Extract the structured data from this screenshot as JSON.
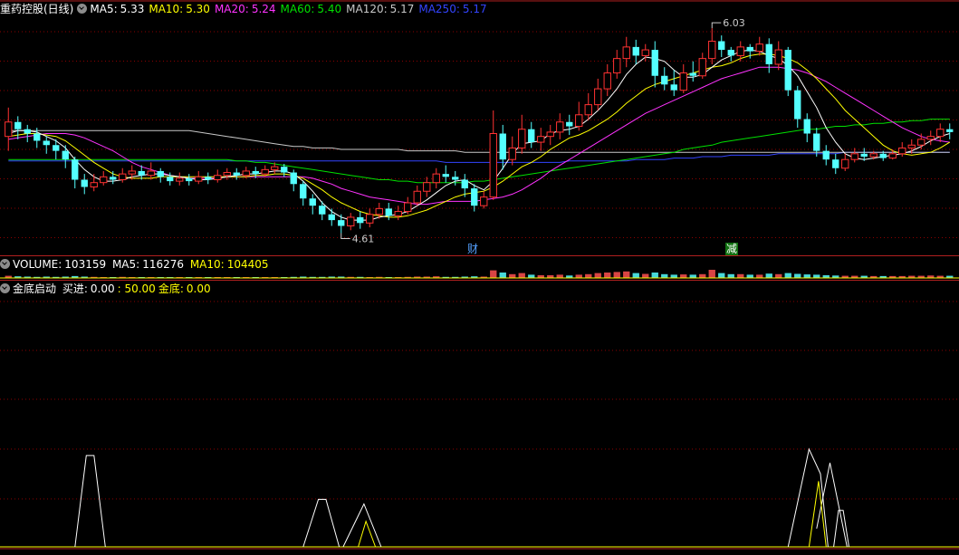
{
  "main_header": {
    "title": "重药控股(日线)",
    "ma": [
      {
        "label": "MA5:",
        "value": "5.33",
        "color": "#ffffff"
      },
      {
        "label": "MA10:",
        "value": "5.30",
        "color": "#ffff00"
      },
      {
        "label": "MA20:",
        "value": "5.24",
        "color": "#ff33ff"
      },
      {
        "label": "MA60:",
        "value": "5.40",
        "color": "#00e000"
      },
      {
        "label": "MA120:",
        "value": "5.17",
        "color": "#c8c8c8"
      },
      {
        "label": "MA250:",
        "value": "5.17",
        "color": "#3344ff"
      }
    ]
  },
  "volume_header": {
    "title": "VOLUME:",
    "value": "103159",
    "ma5_label": "MA5:",
    "ma5_value": "116276",
    "ma10_label": "MA10:",
    "ma10_value": "104405"
  },
  "indicator_header": {
    "title": "金底启动",
    "buy_label": "买进:",
    "buy_value": "0.00",
    "ref_value": ": 50.00",
    "gold_label": "金底:",
    "gold_value": "0.00"
  },
  "markers": {
    "high_label": "6.03",
    "low_label": "4.61",
    "event1": "财",
    "event2": "减"
  },
  "colors": {
    "up": "#ff3232",
    "down": "#54ffff",
    "grid": "#8b0000",
    "separator": "#b02020"
  },
  "chart_data": {
    "type": "candlestick",
    "price_range": [
      4.5,
      6.1
    ],
    "candles": [
      [
        5.28,
        5.38,
        5.18,
        5.48
      ],
      [
        5.38,
        5.33,
        5.26,
        5.42
      ],
      [
        5.33,
        5.3,
        5.24,
        5.36
      ],
      [
        5.3,
        5.25,
        5.2,
        5.34
      ],
      [
        5.25,
        5.22,
        5.16,
        5.28
      ],
      [
        5.22,
        5.18,
        5.12,
        5.26
      ],
      [
        5.18,
        5.12,
        5.06,
        5.22
      ],
      [
        5.12,
        4.98,
        4.92,
        5.14
      ],
      [
        4.98,
        4.93,
        4.88,
        5.02
      ],
      [
        4.93,
        4.96,
        4.9,
        5.02
      ],
      [
        4.96,
        5.0,
        4.94,
        5.04
      ],
      [
        5.0,
        4.98,
        4.95,
        5.04
      ],
      [
        4.98,
        5.02,
        4.96,
        5.06
      ],
      [
        5.02,
        5.04,
        4.98,
        5.08
      ],
      [
        5.04,
        5.01,
        4.98,
        5.08
      ],
      [
        5.01,
        5.04,
        4.98,
        5.1
      ],
      [
        5.04,
        5.0,
        4.96,
        5.06
      ],
      [
        5.0,
        4.97,
        4.94,
        5.03
      ],
      [
        4.97,
        4.99,
        4.94,
        5.03
      ],
      [
        4.99,
        4.97,
        4.94,
        5.02
      ],
      [
        4.97,
        5.0,
        4.95,
        5.04
      ],
      [
        5.0,
        4.98,
        4.95,
        5.03
      ],
      [
        4.98,
        5.01,
        4.96,
        5.05
      ],
      [
        5.01,
        5.03,
        4.98,
        5.06
      ],
      [
        5.03,
        5.01,
        4.98,
        5.06
      ],
      [
        5.01,
        5.04,
        4.99,
        5.07
      ],
      [
        5.04,
        5.02,
        4.99,
        5.07
      ],
      [
        5.02,
        5.05,
        5.0,
        5.08
      ],
      [
        5.05,
        5.07,
        5.02,
        5.1
      ],
      [
        5.07,
        5.03,
        5.0,
        5.09
      ],
      [
        5.03,
        4.95,
        4.9,
        5.05
      ],
      [
        4.95,
        4.85,
        4.8,
        4.97
      ],
      [
        4.85,
        4.8,
        4.74,
        4.88
      ],
      [
        4.8,
        4.74,
        4.7,
        4.83
      ],
      [
        4.74,
        4.7,
        4.66,
        4.78
      ],
      [
        4.7,
        4.66,
        4.61,
        4.74
      ],
      [
        4.66,
        4.72,
        4.63,
        4.75
      ],
      [
        4.72,
        4.68,
        4.64,
        4.76
      ],
      [
        4.68,
        4.74,
        4.65,
        4.78
      ],
      [
        4.74,
        4.78,
        4.71,
        4.82
      ],
      [
        4.78,
        4.73,
        4.7,
        4.82
      ],
      [
        4.73,
        4.76,
        4.7,
        4.8
      ],
      [
        4.76,
        4.82,
        4.74,
        4.86
      ],
      [
        4.82,
        4.9,
        4.8,
        4.94
      ],
      [
        4.9,
        4.96,
        4.86,
        5.0
      ],
      [
        4.96,
        5.02,
        4.92,
        5.06
      ],
      [
        5.02,
        5.0,
        4.96,
        5.08
      ],
      [
        5.0,
        4.98,
        4.94,
        5.04
      ],
      [
        4.98,
        4.92,
        4.86,
        5.02
      ],
      [
        4.92,
        4.8,
        4.76,
        4.95
      ],
      [
        4.8,
        4.86,
        4.78,
        4.9
      ],
      [
        4.86,
        5.3,
        4.84,
        5.46
      ],
      [
        5.3,
        5.12,
        5.05,
        5.36
      ],
      [
        5.12,
        5.2,
        5.08,
        5.28
      ],
      [
        5.2,
        5.33,
        5.16,
        5.43
      ],
      [
        5.33,
        5.24,
        5.2,
        5.38
      ],
      [
        5.24,
        5.28,
        5.18,
        5.34
      ],
      [
        5.28,
        5.31,
        5.22,
        5.36
      ],
      [
        5.31,
        5.38,
        5.26,
        5.44
      ],
      [
        5.38,
        5.35,
        5.29,
        5.43
      ],
      [
        5.35,
        5.43,
        5.32,
        5.52
      ],
      [
        5.43,
        5.5,
        5.39,
        5.58
      ],
      [
        5.5,
        5.61,
        5.46,
        5.68
      ],
      [
        5.61,
        5.72,
        5.56,
        5.78
      ],
      [
        5.72,
        5.82,
        5.68,
        5.88
      ],
      [
        5.82,
        5.9,
        5.76,
        5.97
      ],
      [
        5.9,
        5.84,
        5.78,
        5.95
      ],
      [
        5.84,
        5.88,
        5.8,
        5.92
      ],
      [
        5.88,
        5.7,
        5.62,
        5.94
      ],
      [
        5.7,
        5.64,
        5.6,
        5.76
      ],
      [
        5.64,
        5.6,
        5.56,
        5.74
      ],
      [
        5.6,
        5.72,
        5.58,
        5.78
      ],
      [
        5.72,
        5.7,
        5.66,
        5.8
      ],
      [
        5.7,
        5.82,
        5.68,
        5.86
      ],
      [
        5.82,
        5.94,
        5.78,
        6.03
      ],
      [
        5.94,
        5.88,
        5.83,
        5.98
      ],
      [
        5.88,
        5.84,
        5.8,
        5.9
      ],
      [
        5.84,
        5.9,
        5.8,
        5.94
      ],
      [
        5.9,
        5.87,
        5.82,
        5.92
      ],
      [
        5.87,
        5.92,
        5.84,
        5.97
      ],
      [
        5.92,
        5.78,
        5.72,
        5.96
      ],
      [
        5.78,
        5.88,
        5.74,
        5.94
      ],
      [
        5.88,
        5.6,
        5.56,
        5.9
      ],
      [
        5.6,
        5.4,
        5.34,
        5.63
      ],
      [
        5.4,
        5.3,
        5.24,
        5.44
      ],
      [
        5.3,
        5.18,
        5.14,
        5.34
      ],
      [
        5.18,
        5.12,
        5.08,
        5.22
      ],
      [
        5.12,
        5.06,
        5.02,
        5.16
      ],
      [
        5.06,
        5.12,
        5.04,
        5.16
      ],
      [
        5.12,
        5.16,
        5.1,
        5.2
      ],
      [
        5.16,
        5.14,
        5.11,
        5.2
      ],
      [
        5.14,
        5.16,
        5.12,
        5.18
      ],
      [
        5.16,
        5.13,
        5.11,
        5.18
      ],
      [
        5.13,
        5.16,
        5.12,
        5.19
      ],
      [
        5.16,
        5.2,
        5.14,
        5.24
      ],
      [
        5.2,
        5.22,
        5.16,
        5.26
      ],
      [
        5.22,
        5.26,
        5.19,
        5.3
      ],
      [
        5.26,
        5.28,
        5.22,
        5.32
      ],
      [
        5.28,
        5.33,
        5.24,
        5.37
      ],
      [
        5.33,
        5.31,
        5.26,
        5.37
      ]
    ],
    "ma5": [
      5.3,
      5.32,
      5.32,
      5.31,
      5.28,
      5.25,
      5.2,
      5.12,
      5.05,
      5.0,
      4.97,
      4.97,
      4.98,
      5.0,
      5.01,
      5.02,
      5.02,
      5.01,
      5.0,
      4.99,
      4.98,
      4.98,
      4.99,
      5.0,
      5.01,
      5.02,
      5.02,
      5.03,
      5.04,
      5.04,
      5.02,
      4.97,
      4.9,
      4.82,
      4.76,
      4.72,
      4.7,
      4.7,
      4.7,
      4.72,
      4.73,
      4.74,
      4.76,
      4.8,
      4.84,
      4.89,
      4.94,
      4.97,
      4.98,
      4.94,
      4.91,
      4.97,
      5.06,
      5.16,
      5.23,
      5.24,
      5.25,
      5.3,
      5.32,
      5.33,
      5.35,
      5.4,
      5.46,
      5.53,
      5.61,
      5.71,
      5.78,
      5.83,
      5.82,
      5.8,
      5.74,
      5.69,
      5.69,
      5.71,
      5.76,
      5.81,
      5.84,
      5.87,
      5.88,
      5.87,
      5.84,
      5.82,
      5.77,
      5.7,
      5.59,
      5.48,
      5.34,
      5.24,
      5.16,
      5.13,
      5.12,
      5.13,
      5.14,
      5.15,
      5.16,
      5.18,
      5.21,
      5.25,
      5.28,
      5.3
    ],
    "ma10": [
      5.28,
      5.29,
      5.3,
      5.3,
      5.29,
      5.28,
      5.25,
      5.2,
      5.15,
      5.1,
      5.06,
      5.02,
      5.0,
      4.99,
      4.99,
      4.99,
      5.0,
      5.0,
      5.0,
      5.0,
      5.0,
      5.0,
      5.0,
      5.0,
      5.0,
      5.0,
      5.01,
      5.01,
      5.02,
      5.02,
      5.01,
      4.99,
      4.95,
      4.91,
      4.86,
      4.82,
      4.79,
      4.76,
      4.74,
      4.73,
      4.72,
      4.72,
      4.73,
      4.75,
      4.77,
      4.8,
      4.83,
      4.86,
      4.88,
      4.89,
      4.9,
      4.93,
      4.97,
      5.02,
      5.07,
      5.1,
      5.14,
      5.19,
      5.23,
      5.27,
      5.29,
      5.32,
      5.36,
      5.4,
      5.45,
      5.51,
      5.56,
      5.61,
      5.64,
      5.66,
      5.68,
      5.7,
      5.72,
      5.74,
      5.76,
      5.77,
      5.79,
      5.82,
      5.84,
      5.85,
      5.85,
      5.84,
      5.82,
      5.79,
      5.74,
      5.68,
      5.61,
      5.54,
      5.46,
      5.4,
      5.34,
      5.28,
      5.22,
      5.18,
      5.16,
      5.15,
      5.16,
      5.17,
      5.2,
      5.24
    ],
    "ma20": [
      5.26,
      5.27,
      5.28,
      5.29,
      5.3,
      5.3,
      5.3,
      5.29,
      5.27,
      5.24,
      5.21,
      5.18,
      5.14,
      5.1,
      5.07,
      5.05,
      5.03,
      5.01,
      5.0,
      4.99,
      4.99,
      4.99,
      4.99,
      5.0,
      5.0,
      5.0,
      5.0,
      5.0,
      5.0,
      5.0,
      5.0,
      5.0,
      4.99,
      4.97,
      4.95,
      4.92,
      4.9,
      4.88,
      4.86,
      4.85,
      4.84,
      4.83,
      4.82,
      4.81,
      4.81,
      4.82,
      4.83,
      4.83,
      4.83,
      4.83,
      4.84,
      4.85,
      4.86,
      4.88,
      4.91,
      4.95,
      4.99,
      5.04,
      5.08,
      5.12,
      5.16,
      5.2,
      5.24,
      5.28,
      5.32,
      5.36,
      5.4,
      5.44,
      5.47,
      5.5,
      5.53,
      5.56,
      5.59,
      5.62,
      5.65,
      5.68,
      5.7,
      5.72,
      5.74,
      5.76,
      5.76,
      5.76,
      5.75,
      5.74,
      5.72,
      5.69,
      5.66,
      5.62,
      5.58,
      5.54,
      5.5,
      5.46,
      5.42,
      5.38,
      5.34,
      5.31,
      5.28,
      5.26,
      5.25,
      5.24
    ],
    "ma60": [
      5.12,
      5.12,
      5.12,
      5.12,
      5.12,
      5.12,
      5.12,
      5.12,
      5.12,
      5.12,
      5.12,
      5.12,
      5.12,
      5.12,
      5.12,
      5.12,
      5.12,
      5.12,
      5.12,
      5.12,
      5.12,
      5.12,
      5.12,
      5.12,
      5.11,
      5.11,
      5.1,
      5.1,
      5.09,
      5.08,
      5.07,
      5.06,
      5.05,
      5.04,
      5.03,
      5.02,
      5.01,
      5.0,
      4.99,
      4.98,
      4.98,
      4.97,
      4.97,
      4.96,
      4.96,
      4.96,
      4.96,
      4.96,
      4.96,
      4.97,
      4.97,
      4.98,
      4.99,
      5.0,
      5.01,
      5.02,
      5.03,
      5.04,
      5.05,
      5.06,
      5.07,
      5.08,
      5.09,
      5.1,
      5.11,
      5.12,
      5.13,
      5.14,
      5.15,
      5.16,
      5.17,
      5.19,
      5.2,
      5.21,
      5.22,
      5.24,
      5.25,
      5.26,
      5.27,
      5.28,
      5.29,
      5.3,
      5.31,
      5.32,
      5.33,
      5.33,
      5.34,
      5.35,
      5.35,
      5.36,
      5.36,
      5.37,
      5.37,
      5.38,
      5.38,
      5.39,
      5.39,
      5.4,
      5.4,
      5.4
    ],
    "ma120": [
      5.32,
      5.32,
      5.32,
      5.32,
      5.32,
      5.32,
      5.32,
      5.32,
      5.32,
      5.32,
      5.32,
      5.32,
      5.32,
      5.32,
      5.32,
      5.32,
      5.32,
      5.32,
      5.32,
      5.32,
      5.31,
      5.3,
      5.29,
      5.28,
      5.27,
      5.26,
      5.25,
      5.24,
      5.23,
      5.22,
      5.21,
      5.21,
      5.2,
      5.2,
      5.2,
      5.19,
      5.19,
      5.19,
      5.19,
      5.19,
      5.19,
      5.19,
      5.18,
      5.18,
      5.18,
      5.18,
      5.18,
      5.18,
      5.17,
      5.17,
      5.17,
      5.17,
      5.17,
      5.17,
      5.17,
      5.17,
      5.17,
      5.17,
      5.17,
      5.17,
      5.17,
      5.17,
      5.17,
      5.17,
      5.17,
      5.17,
      5.17,
      5.17,
      5.17,
      5.17,
      5.17,
      5.17,
      5.17,
      5.17,
      5.17,
      5.17,
      5.17,
      5.17,
      5.17,
      5.17,
      5.17,
      5.17,
      5.17,
      5.17,
      5.17,
      5.17,
      5.17,
      5.17,
      5.17,
      5.17,
      5.17,
      5.17,
      5.17,
      5.17,
      5.17,
      5.17,
      5.17,
      5.17,
      5.17,
      5.17
    ],
    "ma250": [
      5.11,
      5.11,
      5.11,
      5.11,
      5.11,
      5.11,
      5.11,
      5.11,
      5.11,
      5.11,
      5.11,
      5.11,
      5.11,
      5.11,
      5.11,
      5.11,
      5.11,
      5.11,
      5.11,
      5.11,
      5.11,
      5.11,
      5.11,
      5.11,
      5.11,
      5.11,
      5.11,
      5.11,
      5.11,
      5.11,
      5.11,
      5.11,
      5.11,
      5.11,
      5.11,
      5.11,
      5.11,
      5.11,
      5.11,
      5.11,
      5.11,
      5.11,
      5.11,
      5.11,
      5.11,
      5.11,
      5.1,
      5.1,
      5.1,
      5.1,
      5.1,
      5.1,
      5.1,
      5.1,
      5.1,
      5.1,
      5.1,
      5.1,
      5.1,
      5.11,
      5.11,
      5.11,
      5.11,
      5.11,
      5.11,
      5.11,
      5.12,
      5.12,
      5.12,
      5.12,
      5.13,
      5.13,
      5.13,
      5.14,
      5.14,
      5.14,
      5.15,
      5.15,
      5.15,
      5.15,
      5.15,
      5.16,
      5.16,
      5.16,
      5.16,
      5.16,
      5.16,
      5.16,
      5.17,
      5.17,
      5.17,
      5.17,
      5.17,
      5.17,
      5.17,
      5.17,
      5.17,
      5.17,
      5.17,
      5.17
    ],
    "volume": [
      0.08,
      0.06,
      0.05,
      0.04,
      0.05,
      0.04,
      0.05,
      0.07,
      0.05,
      0.04,
      0.03,
      0.03,
      0.04,
      0.03,
      0.03,
      0.03,
      0.03,
      0.03,
      0.02,
      0.02,
      0.03,
      0.02,
      0.02,
      0.03,
      0.02,
      0.03,
      0.02,
      0.03,
      0.03,
      0.03,
      0.04,
      0.05,
      0.04,
      0.04,
      0.05,
      0.05,
      0.04,
      0.04,
      0.03,
      0.04,
      0.03,
      0.03,
      0.04,
      0.05,
      0.05,
      0.06,
      0.04,
      0.04,
      0.05,
      0.06,
      0.05,
      0.28,
      0.2,
      0.14,
      0.18,
      0.12,
      0.1,
      0.1,
      0.12,
      0.09,
      0.12,
      0.14,
      0.18,
      0.2,
      0.22,
      0.24,
      0.18,
      0.15,
      0.2,
      0.14,
      0.12,
      0.13,
      0.12,
      0.14,
      0.3,
      0.18,
      0.14,
      0.14,
      0.12,
      0.12,
      0.16,
      0.14,
      0.18,
      0.15,
      0.13,
      0.12,
      0.1,
      0.09,
      0.08,
      0.08,
      0.08,
      0.07,
      0.07,
      0.07,
      0.07,
      0.08,
      0.08,
      0.09,
      0.08,
      0.08
    ],
    "indicator": {
      "gold_bottom": [
        [
          0.0,
          0.08,
          0.12,
          0.2
        ],
        [
          0.4,
          0.43,
          0.45,
          0.48
        ],
        [
          0.5,
          0.52,
          0.55,
          0.6
        ],
        [
          0.84,
          0.86,
          0.88,
          0.92
        ]
      ],
      "peaks": [
        {
          "series": "white",
          "points": [
            [
              7,
              0
            ],
            [
              8.2,
              100
            ],
            [
              9,
              100
            ],
            [
              10.2,
              0
            ]
          ]
        },
        {
          "series": "white",
          "points": [
            [
              31,
              0
            ],
            [
              32.6,
              52
            ],
            [
              33.4,
              52
            ],
            [
              34.8,
              0
            ]
          ]
        },
        {
          "series": "white",
          "points": [
            [
              35.2,
              0
            ],
            [
              37.4,
              47
            ],
            [
              39.2,
              0
            ]
          ]
        },
        {
          "series": "yellow",
          "points": [
            [
              36.8,
              0
            ],
            [
              37.6,
              28
            ],
            [
              38.6,
              0
            ]
          ]
        },
        {
          "series": "white",
          "points": [
            [
              82,
              0
            ],
            [
              84.2,
              107
            ],
            [
              85.4,
              80
            ],
            [
              86.2,
              0
            ]
          ]
        },
        {
          "series": "white",
          "points": [
            [
              85,
              20
            ],
            [
              86.4,
              92
            ],
            [
              88.2,
              0
            ]
          ]
        },
        {
          "series": "yellow",
          "points": [
            [
              84.2,
              0
            ],
            [
              85.2,
              72
            ],
            [
              86,
              0
            ]
          ]
        },
        {
          "series": "white",
          "points": [
            [
              86.8,
              0
            ],
            [
              87.3,
              40
            ],
            [
              87.8,
              40
            ],
            [
              88.4,
              0
            ]
          ]
        }
      ],
      "y_range": [
        0,
        115
      ]
    }
  }
}
